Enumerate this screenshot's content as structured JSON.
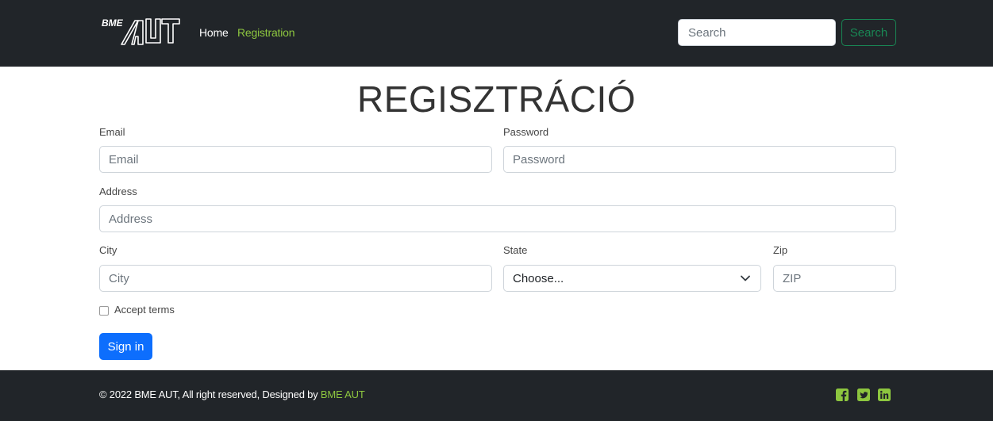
{
  "navbar": {
    "logo_text": "BME AUT",
    "links": [
      {
        "label": "Home"
      },
      {
        "label": "Registration"
      }
    ],
    "search": {
      "placeholder": "Search",
      "button_label": "Search"
    }
  },
  "main": {
    "title": "REGISZTRÁCIÓ",
    "email": {
      "label": "Email",
      "placeholder": "Email"
    },
    "password": {
      "label": "Password",
      "placeholder": "Password"
    },
    "address": {
      "label": "Address",
      "placeholder": "Address"
    },
    "city": {
      "label": "City",
      "placeholder": "City"
    },
    "state": {
      "label": "State",
      "selected": "Choose..."
    },
    "zip": {
      "label": "Zip",
      "placeholder": "ZIP"
    },
    "accept_terms": {
      "label": "Accept terms",
      "checked": false
    },
    "submit_label": "Sign in"
  },
  "footer": {
    "text_prefix": "© 2022 BME AUT, All right reserved, Designed by ",
    "link_text": "BME AUT",
    "social_icons": [
      "facebook-icon",
      "twitter-icon",
      "linkedin-icon"
    ]
  },
  "colors": {
    "navbar_bg": "#212529",
    "accent_green": "#8dc63f",
    "search_green": "#198754",
    "primary_blue": "#0d6efd"
  }
}
